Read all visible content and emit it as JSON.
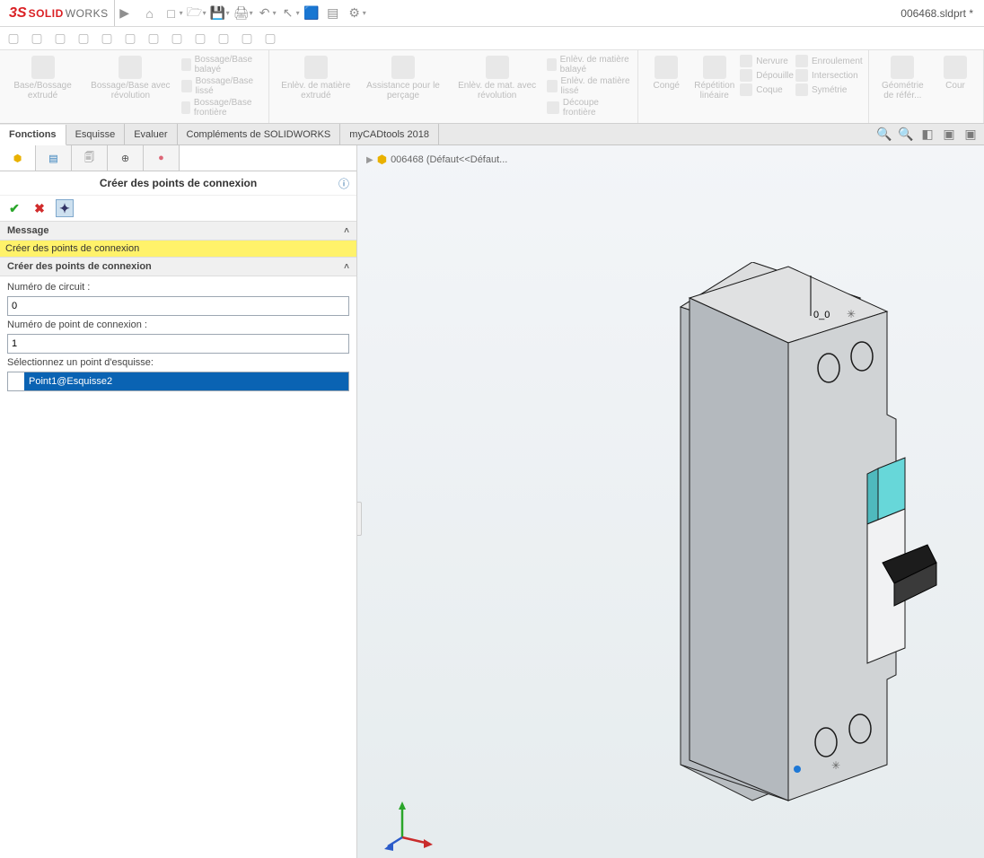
{
  "title": "006468.sldprt *",
  "logo": {
    "prefix": "3S",
    "brand1": "SOLID",
    "brand2": "WORKS"
  },
  "ribbon": {
    "items": [
      "Base/Bossage extrudé",
      "Bossage/Base avec révolution",
      "Bossage/Base balayé",
      "Bossage/Base lissé",
      "Bossage/Base frontière",
      "Enlèv. de matière extrudé",
      "Assistance pour le perçage",
      "Enlèv. de mat. avec révolution",
      "Enlèv. de matière balayé",
      "Enlèv. de matière lissé",
      "Découpe frontière",
      "Congé",
      "Répétition linéaire",
      "Nervure",
      "Dépouille",
      "Coque",
      "Enroulement",
      "Intersection",
      "Symétrie",
      "Géométrie de référ...",
      "Cour"
    ]
  },
  "tabs": [
    "Fonctions",
    "Esquisse",
    "Evaluer",
    "Compléments de SOLIDWORKS",
    "myCADtools 2018"
  ],
  "activeTab": 0,
  "panel": {
    "title": "Créer des points de connexion",
    "sections": {
      "message_head": "Message",
      "message_body": "Créer des points de connexion",
      "form_head": "Créer des points de connexion",
      "label_circuit": "Numéro de circuit :",
      "val_circuit": "0",
      "label_point": "Numéro de point de connexion :",
      "val_point": "1",
      "label_select": "Sélectionnez un point d'esquisse:",
      "selected": "Point1@Esquisse2"
    }
  },
  "tree_label": "006468  (Défaut<<Défaut...",
  "origin_label": "0_0"
}
